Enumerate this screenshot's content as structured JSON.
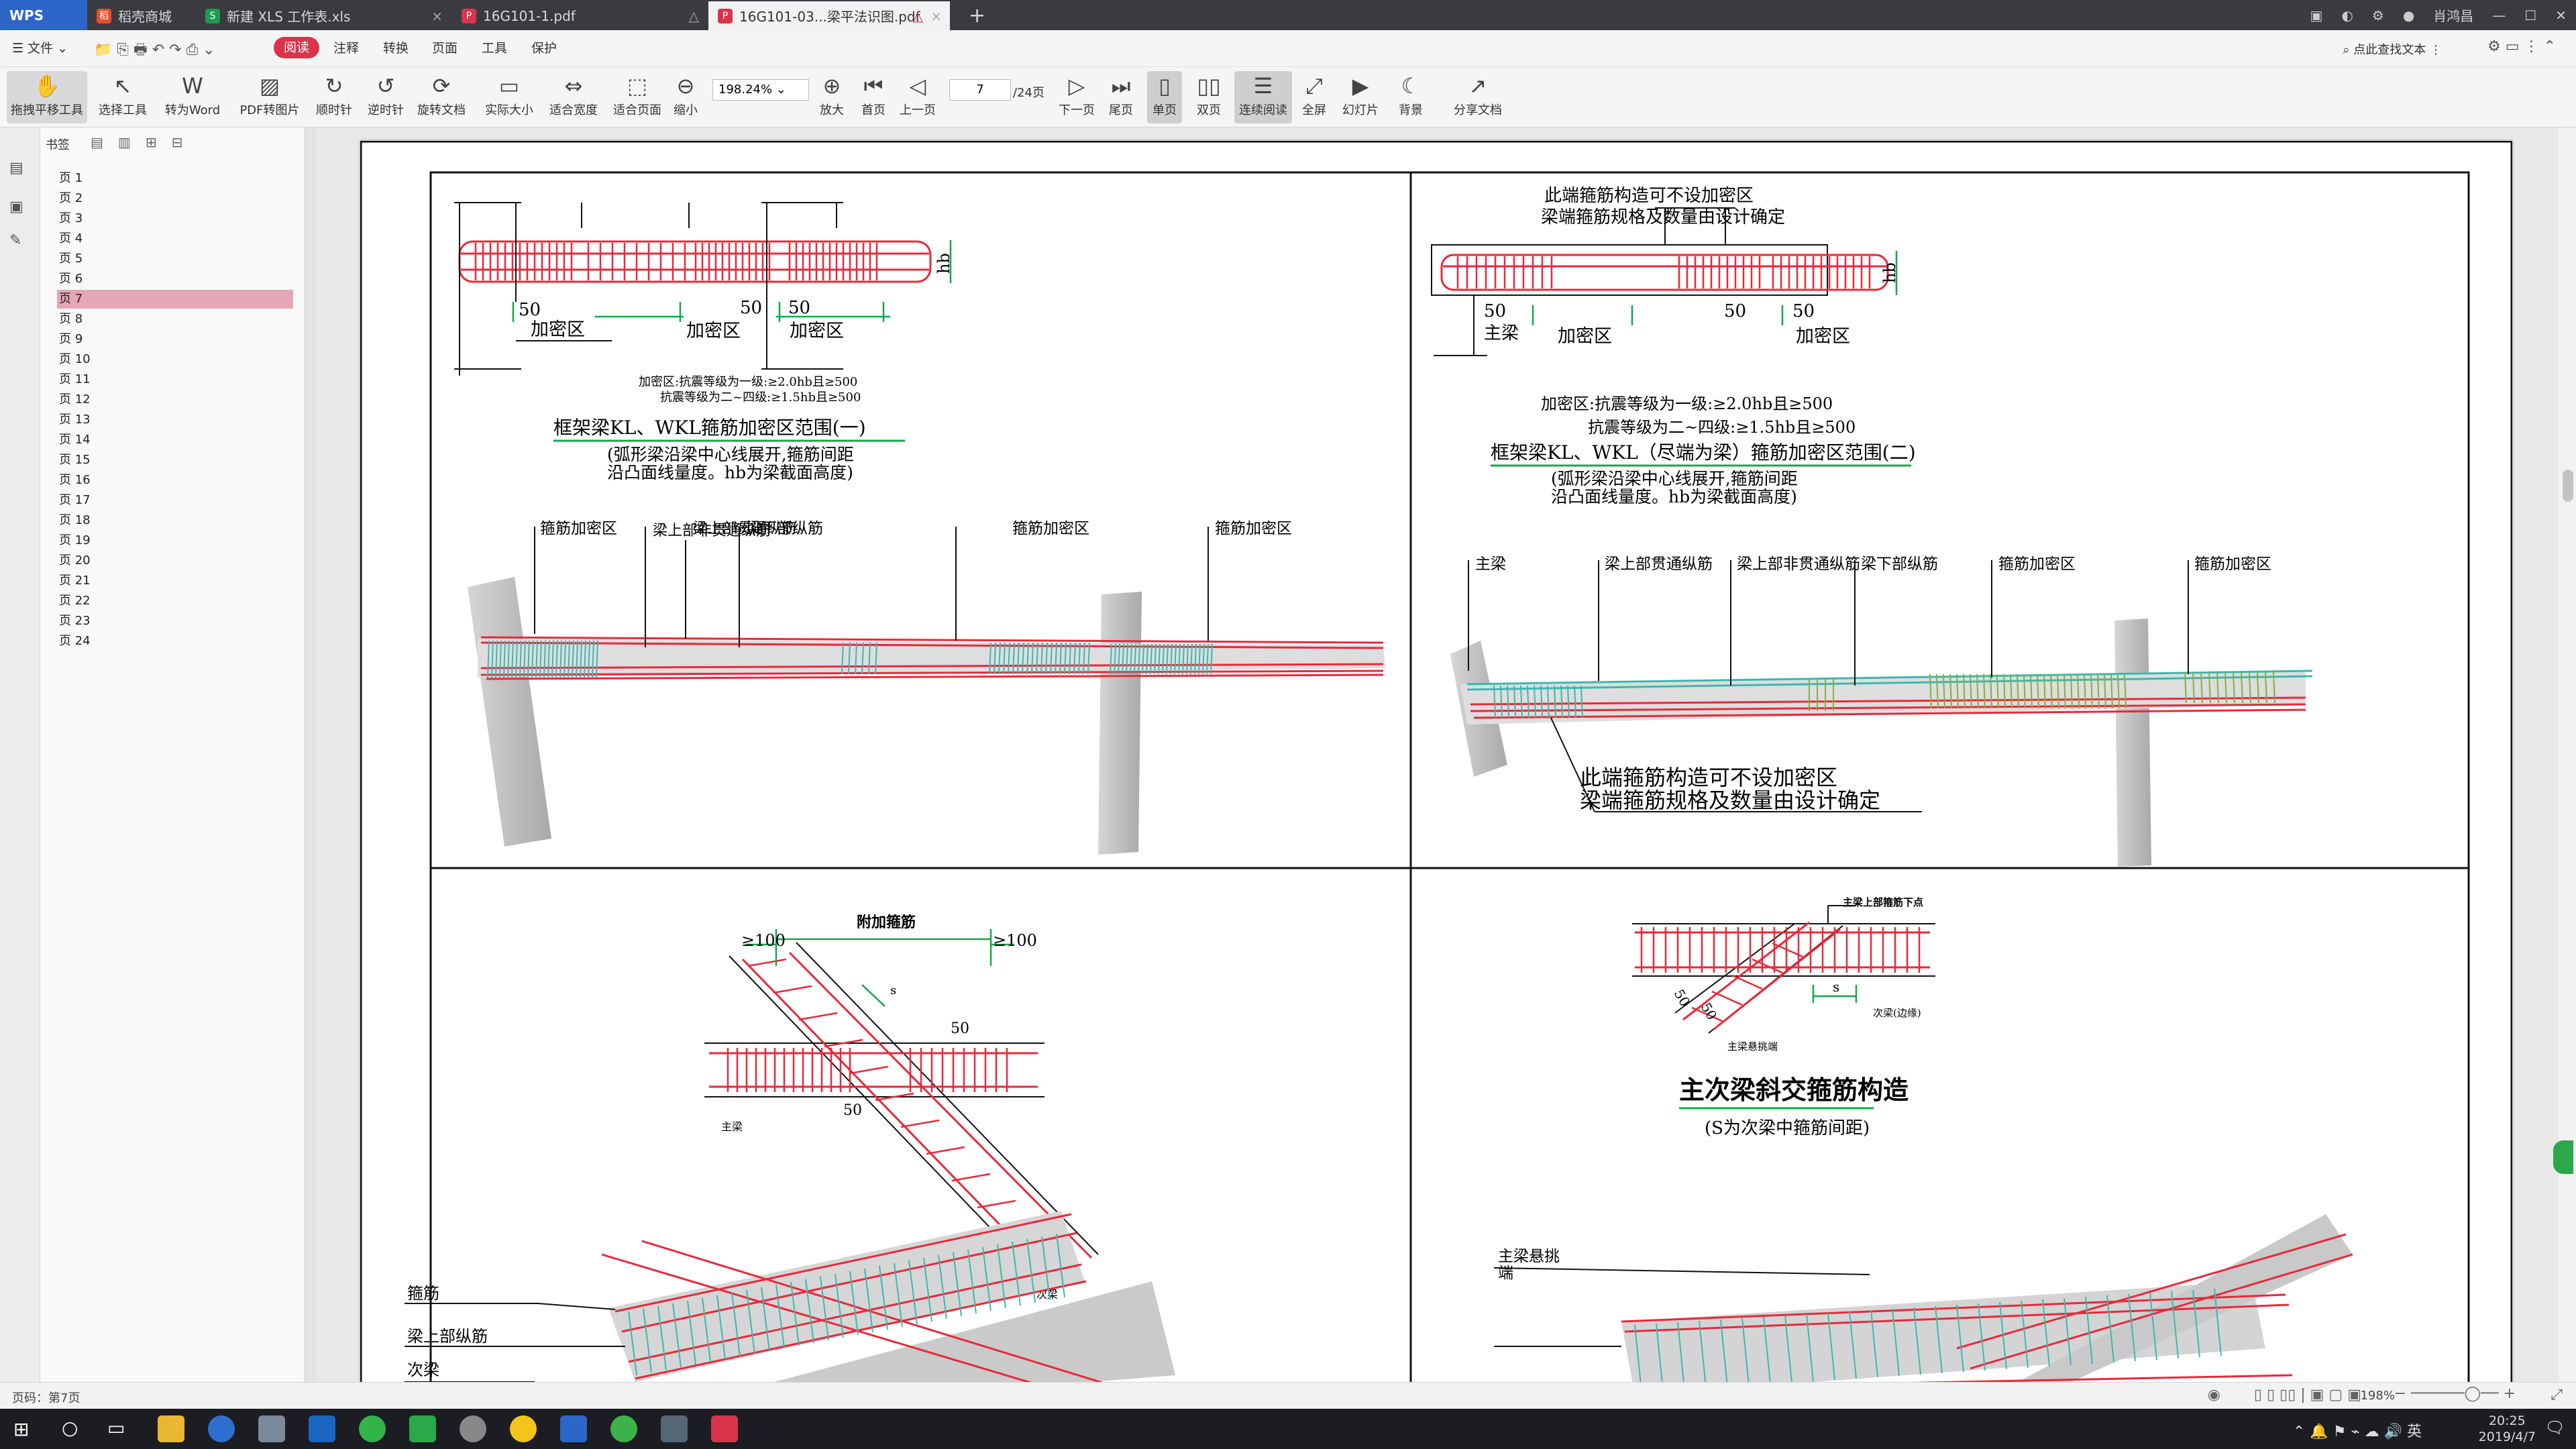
{
  "titlebar": {
    "app": "WPS",
    "tabs": [
      {
        "label": "稻壳商城"
      },
      {
        "label": "新建 XLS 工作表.xls"
      },
      {
        "label": "16G101-1.pdf"
      },
      {
        "label": "16G101-03...梁平法识图.pdf"
      }
    ],
    "user": "肖鸿昌"
  },
  "menubar": {
    "file": "文件",
    "items": [
      "阅读",
      "注释",
      "转换",
      "页面",
      "工具",
      "保护"
    ],
    "search": "点此查找文本"
  },
  "toolbar": {
    "tools": [
      "拖拽平移工具",
      "选择工具",
      "转为Word",
      "PDF转图片",
      "顺时针",
      "逆时针",
      "旋转文档",
      "实际大小",
      "适合宽度",
      "适合页面",
      "缩小",
      "放大",
      "首页",
      "上一页",
      "下一页",
      "尾页",
      "单页",
      "双页",
      "连续阅读",
      "全屏",
      "幻灯片",
      "背景",
      "分享文档"
    ],
    "zoom": "198.24%",
    "page": "7",
    "total": "/24页"
  },
  "sidebar": {
    "title": "书签",
    "pages": [
      "页 1",
      "页 2",
      "页 3",
      "页 4",
      "页 5",
      "页 6",
      "页 7",
      "页 8",
      "页 9",
      "页 10",
      "页 11",
      "页 12",
      "页 13",
      "页 14",
      "页 15",
      "页 16",
      "页 17",
      "页 18",
      "页 19",
      "页 20",
      "页 21",
      "页 22",
      "页 23",
      "页 24"
    ],
    "selected": "页 7"
  },
  "drawing": {
    "q1": {
      "dense": [
        "加密区",
        "加密区",
        "加密区"
      ],
      "d50": [
        "50",
        "50",
        "50"
      ],
      "hb": "hb",
      "note1": "加密区:抗震等级为一级:≥2.0hb且≥500",
      "note2": "抗震等级为二~四级:≥1.5hb且≥500",
      "title": "框架梁KL、WKL箍筋加密区范围(一)",
      "sub1": "(弧形梁沿梁中心线展开,箍筋间距",
      "sub2": "沿凸面线量度。hb为梁截面高度)",
      "labels": [
        "箍筋加密区",
        "梁上部非贯通纵筋",
        "梁上部贯通纵筋",
        "梁下部纵筋",
        "箍筋加密区",
        "箍筋加密区"
      ]
    },
    "q2": {
      "top1": "此端箍筋构造可不设加密区",
      "top2": "梁端箍筋规格及数量由设计确定",
      "main": "主梁",
      "dense": [
        "加密区",
        "加密区"
      ],
      "d50": [
        "50",
        "50",
        "50"
      ],
      "hb": "hb",
      "note1": "加密区:抗震等级为一级:≥2.0hb且≥500",
      "note2": "抗震等级为二~四级:≥1.5hb且≥500",
      "title": "框架梁KL、WKL（尽端为梁）箍筋加密区范围(二)",
      "sub1": "(弧形梁沿梁中心线展开,箍筋间距",
      "sub2": "沿凸面线量度。hb为梁截面高度)",
      "labels": [
        "主梁",
        "梁上部贯通纵筋",
        "梁上部非贯通纵筋",
        "梁下部纵筋",
        "箍筋加密区",
        "箍筋加密区"
      ],
      "c1": "此端箍筋构造可不设加密区",
      "c2": "梁端箍筋规格及数量由设计确定"
    },
    "q3": {
      "extra": "附加箍筋",
      "d100a": "≥100",
      "d100b": "≥100",
      "s": "s",
      "d50a": "50",
      "d50b": "50",
      "main": "主梁",
      "sec": "次梁",
      "labels": [
        "箍筋",
        "梁上部纵筋",
        "次梁"
      ]
    },
    "q4": {
      "topnote": "主梁上部箍筋下点",
      "s": "s",
      "d50a": "50",
      "d50b": "50",
      "sec": "次梁(边缘)",
      "mainlbl": "主梁悬挑端",
      "title": "主次梁斜交箍筋构造",
      "sub": "(S为次梁中箍筋间距)",
      "lbl1": "主梁悬挑",
      "lbl2": "端"
    }
  },
  "status": {
    "page": "页码：第7页",
    "zoom": "198%"
  },
  "taskbar": {
    "time": "20:25",
    "date": "2019/4/7"
  },
  "colors": {
    "red": "#e8293a",
    "green": "#11a84a",
    "teal": "#3cb8b0",
    "concrete": "#c9c9c9"
  }
}
